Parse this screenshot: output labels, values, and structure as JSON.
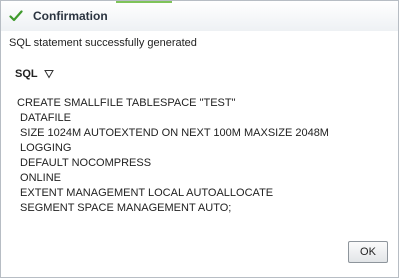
{
  "dialog": {
    "title": "Confirmation",
    "message": "SQL statement successfully generated",
    "icon": "green-checkmark-icon",
    "accent_color": "#7fc45a"
  },
  "sql_section": {
    "label": "SQL",
    "toggle_icon": "triangle-down-icon",
    "lines": [
      "CREATE SMALLFILE TABLESPACE \"TEST\"",
      " DATAFILE",
      " SIZE 1024M AUTOEXTEND ON NEXT 100M MAXSIZE 2048M",
      " LOGGING",
      " DEFAULT NOCOMPRESS",
      " ONLINE",
      " EXTENT MANAGEMENT LOCAL AUTOALLOCATE",
      " SEGMENT SPACE MANAGEMENT AUTO;"
    ]
  },
  "buttons": {
    "ok_label": "OK"
  }
}
